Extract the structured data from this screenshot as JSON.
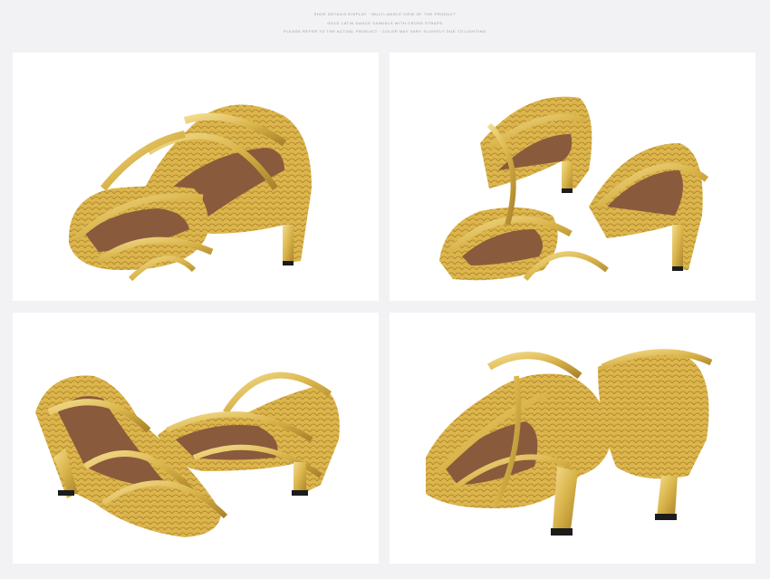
{
  "header": {
    "caption_lines": [
      "SHOE DETAILS DISPLAY · MULTI-ANGLE VIEW OF THE PRODUCT",
      "GOLD LATIN DANCE SANDALS WITH CROSS STRAPS",
      "PLEASE REFER TO THE ACTUAL PRODUCT · COLOR MAY VARY SLIGHTLY DUE TO LIGHTING"
    ]
  },
  "product": {
    "color_gold": "#d9b44a",
    "color_gold_dark": "#a9822a",
    "color_gold_light": "#f3dc8e",
    "color_insole": "#8a5a3c",
    "color_heel_tip": "#1c1c1c"
  },
  "views": [
    {
      "name": "front-three-quarter"
    },
    {
      "name": "side-three-quarter"
    },
    {
      "name": "pair-side"
    },
    {
      "name": "back-heels"
    }
  ]
}
